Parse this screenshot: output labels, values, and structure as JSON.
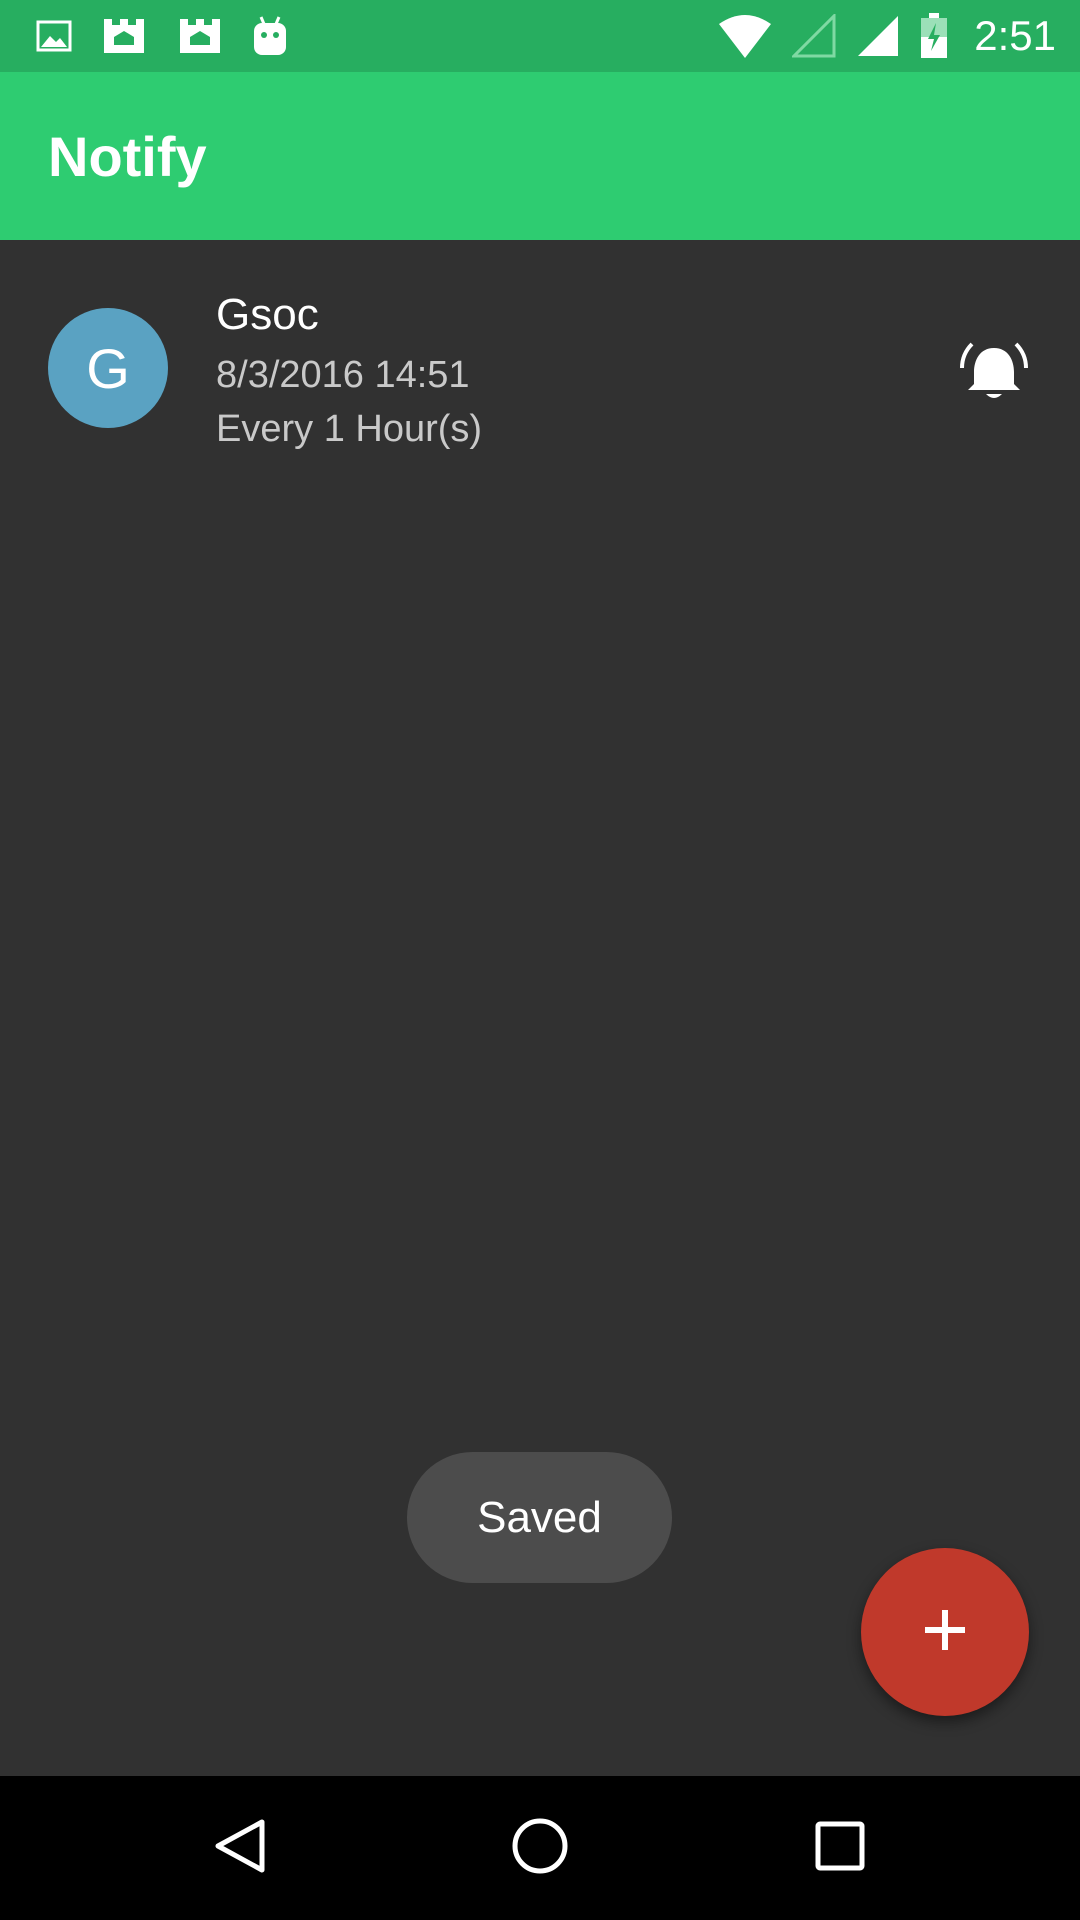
{
  "status_bar": {
    "time": "2:51",
    "icons": [
      "image-icon",
      "app-notification-icon",
      "app-notification-icon",
      "android-icon",
      "wifi-icon",
      "signal-empty-icon",
      "signal-full-icon",
      "battery-charging-icon"
    ],
    "color": "#27AE60"
  },
  "app_bar": {
    "title": "Notify",
    "color": "#2ECC71"
  },
  "reminders": [
    {
      "avatar_letter": "G",
      "avatar_color": "#5AA2C2",
      "title": "Gsoc",
      "datetime": "8/3/2016 14:51",
      "repeat": "Every 1 Hour(s)",
      "icon": "alarm-on-icon"
    }
  ],
  "toast": {
    "text": "Saved"
  },
  "fab": {
    "icon": "plus-icon",
    "color": "#C0392B"
  },
  "nav_bar": {
    "buttons": [
      "back-icon",
      "home-icon",
      "recents-icon"
    ]
  }
}
